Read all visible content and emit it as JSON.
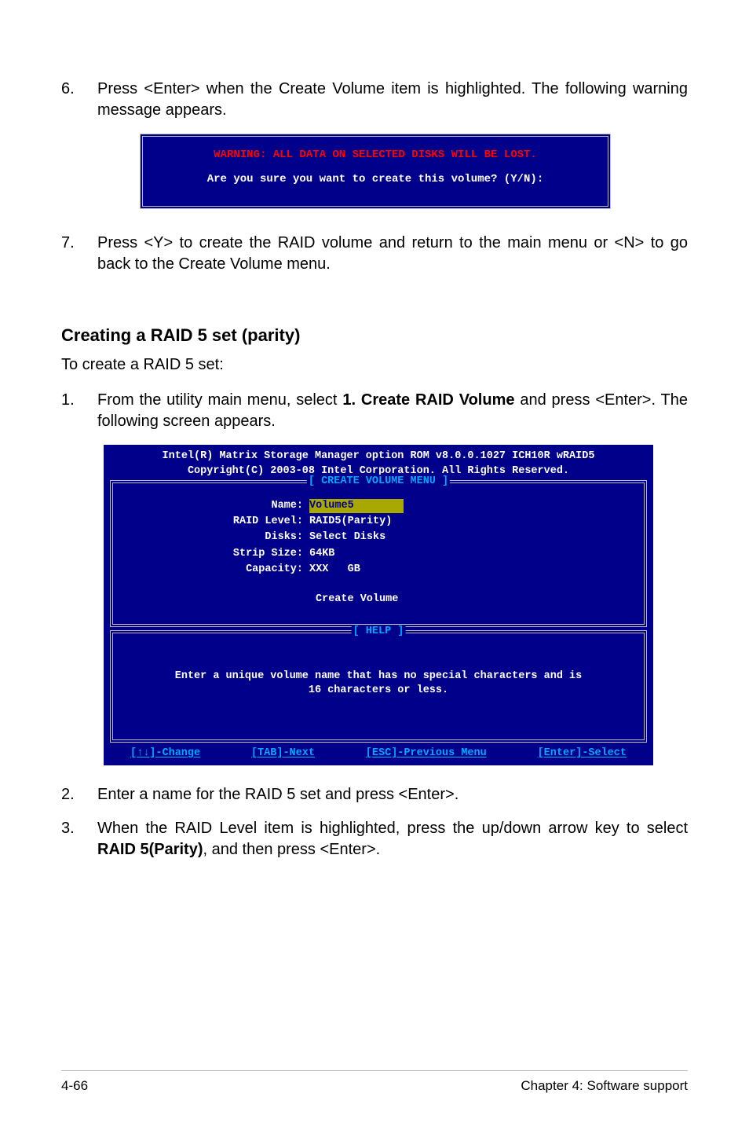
{
  "step6": {
    "num": "6.",
    "text": "Press <Enter> when the Create Volume item is highlighted. The following warning message appears."
  },
  "warning_box": {
    "line1": "WARNING: ALL DATA ON SELECTED DISKS WILL BE LOST.",
    "line2": "Are you sure you want to create this volume? (Y/N):"
  },
  "step7": {
    "num": "7.",
    "text": "Press <Y> to create the RAID volume and return to the main menu or <N> to go back to the Create Volume menu."
  },
  "heading": "Creating a RAID 5 set (parity)",
  "subpara": "To create a RAID 5 set:",
  "step1": {
    "num": "1.",
    "pre": "From the utility main menu, select ",
    "bold": "1. Create RAID Volume",
    "post": " and press <Enter>. The following screen appears."
  },
  "rom": {
    "head1": "Intel(R) Matrix Storage Manager option ROM v8.0.0.1027 ICH10R wRAID5",
    "head2": "Copyright(C) 2003-08 Intel Corporation. All Rights Reserved.",
    "create_title": "[ CREATE VOLUME MENU ]",
    "fields": {
      "name_label": "Name:",
      "name_value": "Volume5",
      "raidlevel_label": "RAID Level:",
      "raidlevel_value": "RAID5(Parity)",
      "disks_label": "Disks:",
      "disks_value": "Select Disks",
      "stripsize_label": "Strip Size:",
      "stripsize_value": "64KB",
      "capacity_label": "Capacity:",
      "capacity_value": "XXX   GB"
    },
    "create_volume": "Create Volume",
    "help_title": "[ HELP ]",
    "help_text": "Enter a unique volume name that has no special characters and is\n16 characters or less.",
    "footer": {
      "change": "[↑↓]-Change",
      "next": "[TAB]-Next",
      "prev": "[ESC]-Previous Menu",
      "select": "[Enter]-Select"
    }
  },
  "step2": {
    "num": "2.",
    "text": "Enter a name for the RAID 5 set and press <Enter>."
  },
  "step3": {
    "num": "3.",
    "pre": "When the RAID Level item is highlighted, press the up/down arrow key to select ",
    "bold": "RAID 5(Parity)",
    "post": ", and then press <Enter>."
  },
  "footer": {
    "left": "4-66",
    "right": "Chapter 4: Software support"
  }
}
